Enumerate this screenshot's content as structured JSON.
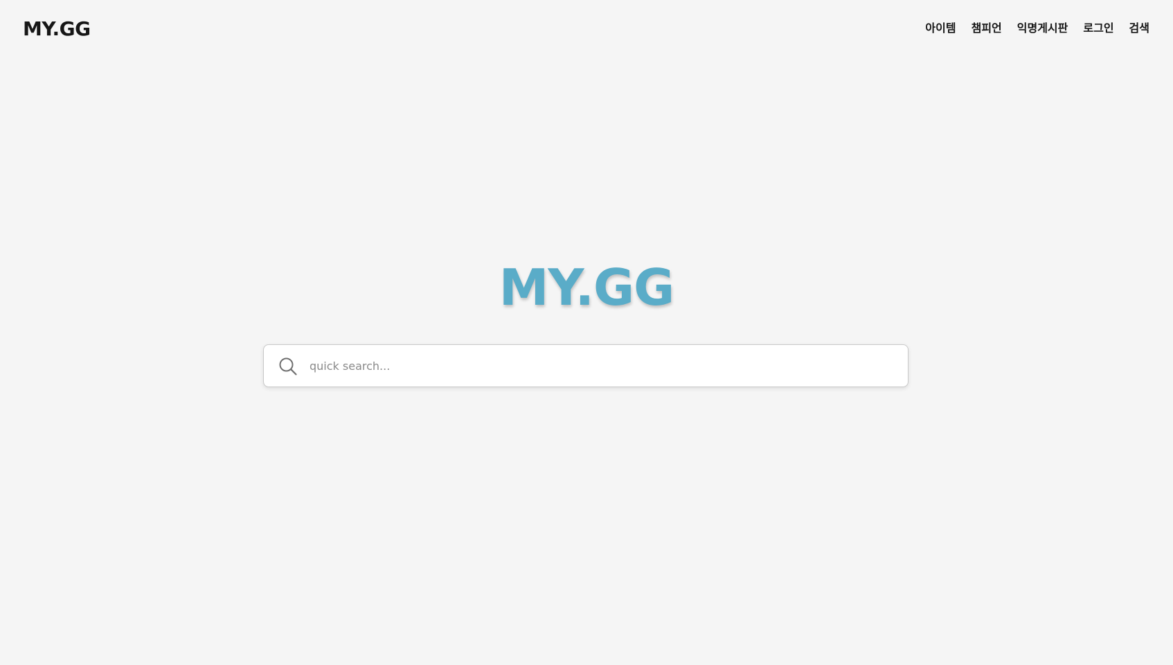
{
  "header": {
    "logo": "MY.GG",
    "nav": [
      {
        "label": "아이템"
      },
      {
        "label": "챔피언"
      },
      {
        "label": "익명게시판"
      },
      {
        "label": "로그인"
      },
      {
        "label": "검색"
      }
    ]
  },
  "hero": {
    "title": "MY.GG"
  },
  "search": {
    "placeholder": "quick search...",
    "value": "",
    "icon": "search-icon"
  },
  "colors": {
    "background": "#f5f5f5",
    "accent": "#5aacc8",
    "text": "#151515"
  }
}
